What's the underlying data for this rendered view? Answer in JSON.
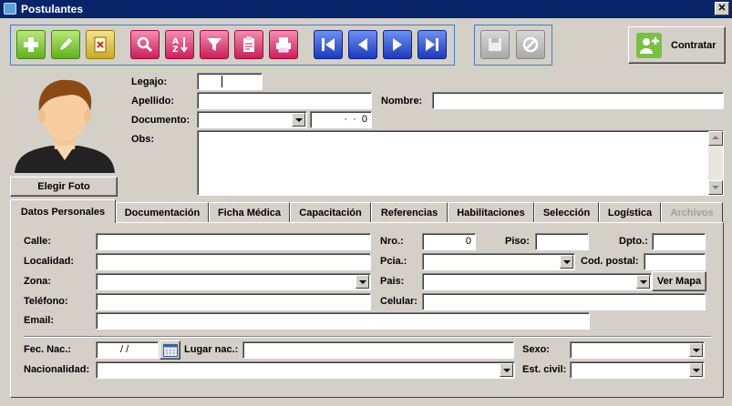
{
  "window": {
    "title": "Postulantes",
    "close_glyph": "✕"
  },
  "toolbar": {
    "buttons": [
      {
        "name": "add-icon"
      },
      {
        "name": "edit-icon"
      },
      {
        "name": "delete-icon"
      },
      {
        "name": "search-icon"
      },
      {
        "name": "sort-icon"
      },
      {
        "name": "filter-icon"
      },
      {
        "name": "report-icon"
      },
      {
        "name": "print-icon"
      },
      {
        "name": "first-record-icon"
      },
      {
        "name": "prev-record-icon"
      },
      {
        "name": "next-record-icon"
      },
      {
        "name": "last-record-icon"
      },
      {
        "name": "save-icon"
      },
      {
        "name": "cancel-icon"
      }
    ],
    "contratar_label": "Contratar"
  },
  "photo": {
    "button_label": "Elegir Foto"
  },
  "header_form": {
    "legajo_label": "Legajo:",
    "legajo_value": "",
    "apellido_label": "Apellido:",
    "nombre_label": "Nombre:",
    "documento_label": "Documento:",
    "documento_number": "  ·  ·  0",
    "obs_label": "Obs:"
  },
  "tabs": [
    {
      "label": "Datos Personales",
      "active": true
    },
    {
      "label": "Documentación"
    },
    {
      "label": "Ficha Médica"
    },
    {
      "label": "Capacitación"
    },
    {
      "label": "Referencias"
    },
    {
      "label": "Habilitaciones"
    },
    {
      "label": "Selección"
    },
    {
      "label": "Logística"
    },
    {
      "label": "Archivos",
      "disabled": true
    }
  ],
  "personal": {
    "calle_label": "Calle:",
    "nro_label": "Nro.:",
    "nro_value": "0",
    "piso_label": "Piso:",
    "dpto_label": "Dpto.:",
    "localidad_label": "Localidad:",
    "pcia_label": "Pcia.:",
    "cod_postal_label": "Cod. postal:",
    "zona_label": "Zona:",
    "pais_label": "Pais:",
    "ver_mapa_label": "Ver Mapa",
    "telefono_label": "Teléfono:",
    "celular_label": "Celular:",
    "email_label": "Email:",
    "fec_nac_label": "Fec. Nac.:",
    "fec_nac_value": "/ /",
    "lugar_nac_label": "Lugar nac.:",
    "sexo_label": "Sexo:",
    "nacionalidad_label": "Nacionalidad:",
    "est_civil_label": "Est. civil:"
  },
  "colors": {
    "titlebar": "#0a246a",
    "window_bg": "#d4d0c8",
    "group_border": "#4a7ac8"
  }
}
